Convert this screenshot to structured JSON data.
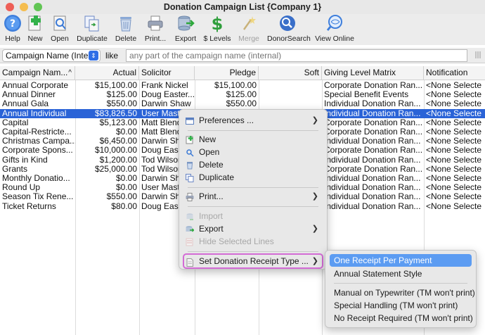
{
  "window": {
    "title": "Donation Campaign List {Company 1}",
    "light_colors": [
      "#ee5f57",
      "#f5bd4f",
      "#61c554"
    ]
  },
  "toolbar": [
    {
      "label": "Help",
      "icon": "help-icon",
      "disabled": false
    },
    {
      "label": "New",
      "icon": "new-icon",
      "disabled": false
    },
    {
      "label": "Open",
      "icon": "open-icon",
      "disabled": false
    },
    {
      "label": "Duplicate",
      "icon": "duplicate-icon",
      "disabled": false
    },
    {
      "label": "Delete",
      "icon": "delete-icon",
      "disabled": false
    },
    {
      "label": "Print...",
      "icon": "print-icon",
      "disabled": false
    },
    {
      "label": "Export",
      "icon": "export-icon",
      "disabled": false
    },
    {
      "label": "$ Levels",
      "icon": "dollar-levels-icon",
      "disabled": false
    },
    {
      "label": "Merge",
      "icon": "merge-icon",
      "disabled": true
    },
    {
      "label": "DonorSearch",
      "icon": "donorsearch-icon",
      "disabled": false
    },
    {
      "label": "View Online",
      "icon": "view-online-icon",
      "disabled": false
    }
  ],
  "filter": {
    "field": "Campaign Name (Inte...",
    "operator": "like",
    "placeholder": "any part of the campaign name (internal)"
  },
  "table": {
    "columns": [
      "Campaign Nam...",
      "Actual",
      "Solicitor",
      "Pledge",
      "Soft",
      "Giving Level Matrix",
      "Notification"
    ],
    "sort_indicator": "^",
    "selected_row": 3,
    "rows": [
      [
        "Annual Corporate",
        "$15,100.00",
        "Frank Nickel",
        "$15,100.00",
        "",
        "Corporate Donation Ran...",
        "<None Selecte"
      ],
      [
        "Annual Dinner",
        "$125.00",
        "Doug Easter...",
        "$125.00",
        "",
        "Special Benefit Events",
        "<None Selecte"
      ],
      [
        "Annual Gala",
        "$550.00",
        "Darwin Shaw",
        "$550.00",
        "",
        "Individual Donation Ran...",
        "<None Selecte"
      ],
      [
        "Annual Individual",
        "$83,826.50",
        "User Maste",
        "",
        "",
        "Individual Donation Ran...",
        "<None Selecte"
      ],
      [
        "Capital",
        "$5,123.00",
        "Matt Blend",
        "",
        "",
        "Corporate Donation Ran...",
        "<None Selecte"
      ],
      [
        "Capital-Restricte...",
        "$0.00",
        "Matt Blend",
        "",
        "",
        "Corporate Donation Ran...",
        "<None Selecte"
      ],
      [
        "Christmas Campa...",
        "$6,450.00",
        "Darwin Sha",
        "",
        "",
        "Individual Donation Ran...",
        "<None Selecte"
      ],
      [
        "Corporate Spons...",
        "$10,000.00",
        "Doug Easte",
        "",
        "",
        "Corporate Donation Ran...",
        "<None Selecte"
      ],
      [
        "Gifts in Kind",
        "$1,200.00",
        "Tod Wilson",
        "",
        "",
        "Individual Donation Ran...",
        "<None Selecte"
      ],
      [
        "Grants",
        "$25,000.00",
        "Tod Wilson",
        "",
        "",
        "Corporate Donation Ran...",
        "<None Selecte"
      ],
      [
        "Monthly Donatio...",
        "$0.00",
        "Darwin Sha",
        "",
        "",
        "Individual Donation Ran...",
        "<None Selecte"
      ],
      [
        "Round Up",
        "$0.00",
        "User Maste",
        "",
        "",
        "Individual Donation Ran...",
        "<None Selecte"
      ],
      [
        "Season Tix Rene...",
        "$550.00",
        "Darwin Sha",
        "",
        "",
        "Individual Donation Ran...",
        "<None Selecte"
      ],
      [
        "Ticket Returns",
        "$80.00",
        "Doug Easte",
        "",
        "",
        "Individual Donation Ran...",
        "<None Selecte"
      ]
    ]
  },
  "context_menu": {
    "items": [
      {
        "label": "Preferences ...",
        "icon": "preferences-icon",
        "submenu": true,
        "disabled": false
      },
      {
        "label": "New",
        "icon": "new-small-icon",
        "submenu": false,
        "disabled": false
      },
      {
        "label": "Open",
        "icon": "open-small-icon",
        "submenu": false,
        "disabled": false
      },
      {
        "label": "Delete",
        "icon": "delete-small-icon",
        "submenu": false,
        "disabled": false
      },
      {
        "label": "Duplicate",
        "icon": "duplicate-small-icon",
        "submenu": false,
        "disabled": false
      },
      {
        "label": "Print...",
        "icon": "print-small-icon",
        "submenu": true,
        "disabled": false
      },
      {
        "label": "Import",
        "icon": "import-icon",
        "submenu": false,
        "disabled": true
      },
      {
        "label": "Export",
        "icon": "export-small-icon",
        "submenu": true,
        "disabled": false
      },
      {
        "label": "Hide Selected Lines",
        "icon": "hide-lines-icon",
        "submenu": false,
        "disabled": true
      },
      {
        "label": "Set Donation Receipt Type ...",
        "icon": "receipt-type-icon",
        "submenu": true,
        "disabled": false
      }
    ],
    "highlight_color": "#d36bd5"
  },
  "submenu": {
    "items": [
      {
        "label": "One Receipt Per Payment",
        "active": true
      },
      {
        "label": "Annual Statement Style",
        "active": false
      },
      {
        "label": "Manual on Typewriter (TM won't print)",
        "active": false
      },
      {
        "label": "Special Handling (TM won't print)",
        "active": false
      },
      {
        "label": "No Receipt Required (TM won't print)",
        "active": false
      }
    ],
    "active_color": "#5c9cf2"
  }
}
